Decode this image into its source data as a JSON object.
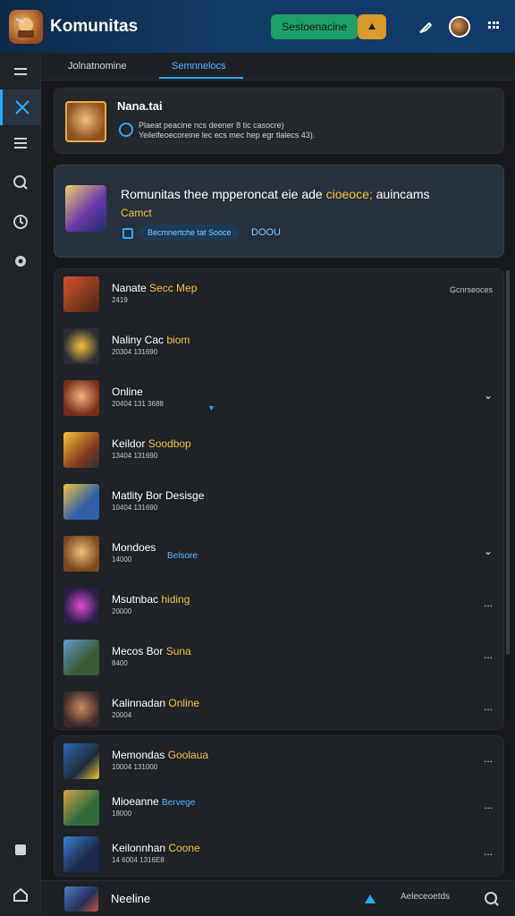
{
  "header": {
    "title": "Komunitas",
    "button_label": "Sestoenacine"
  },
  "tabs": [
    {
      "label": "Jolnatnomine"
    },
    {
      "label": "Semnnelocs"
    }
  ],
  "profile": {
    "name": "Nana.tai",
    "line1": "Plaeat peacine ncs deener 8 tic casocre)",
    "line2": "Yeilelfeoecoreine lec ecs mec hep egr tlalecs 43)."
  },
  "feature": {
    "title_prefix": "Romunitas thee mpperoncat eie ade ",
    "title_highlight": "cioeoce;",
    "title_suffix": " auincams",
    "subtitle": "Camct",
    "chip_label": "Becmnertche tat Sooce",
    "code": "DOOU"
  },
  "list": [
    {
      "title": "Nanate ",
      "highlight": "Secc Mep",
      "sub": "2419",
      "right": "Gcnrseoces"
    },
    {
      "title": "Naliny Cac ",
      "highlight": "biom",
      "sub": "20304 131690",
      "right": ""
    },
    {
      "title": "Online",
      "highlight": "",
      "sub": "20404 131 3688",
      "right": "⌄"
    },
    {
      "title": "Keildor ",
      "highlight": "Soodbop",
      "sub": "13404 131690",
      "right": ""
    },
    {
      "title": "Matlity Bor Desisge",
      "highlight": "",
      "sub": "10404 131690",
      "right": ""
    },
    {
      "title": "Mondoes",
      "highlight": "",
      "blue": "Belsore",
      "sub": "14000",
      "right": "⌄"
    },
    {
      "title": "Msutnbac ",
      "highlight": "hiding",
      "sub": "20000",
      "right": "..."
    },
    {
      "title": "Mecos Bor ",
      "highlight": "Suna",
      "sub": "8400",
      "right": "..."
    },
    {
      "title": "Kalinnadan ",
      "highlight": "Online",
      "sub": "20004",
      "right": "..."
    }
  ],
  "list2": [
    {
      "title": "Memondas ",
      "highlight": "Goolaua",
      "sub": "10004 131000",
      "right": "..."
    },
    {
      "title": "Mioeanne ",
      "highlight": "",
      "blue": "Bervege",
      "sub": "18000",
      "right": "..."
    },
    {
      "title": "Keilonnhan ",
      "highlight": "Coone",
      "sub": "14 6004 1316E8",
      "right": "..."
    }
  ],
  "bottom": {
    "label": "Neeline",
    "right_text": "Aeleceoetds"
  }
}
